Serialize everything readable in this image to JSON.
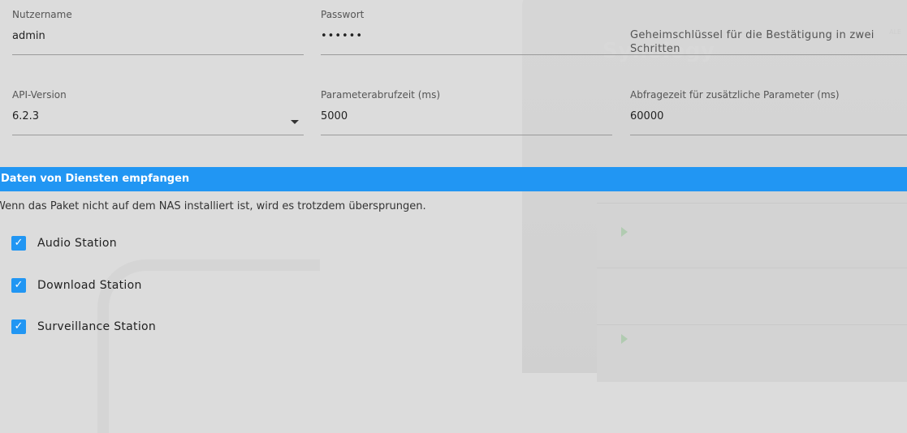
{
  "credentials": {
    "username_label": "Nutzername",
    "username_value": "admin",
    "password_label": "Passwort",
    "password_value": "••••••",
    "secret_label": "Geheimschlüssel für die Bestätigung in zwei Schritten"
  },
  "api": {
    "version_label": "API-Version",
    "version_value": "6.2.3",
    "poll_label": "Parameterabrufzeit (ms)",
    "poll_value": "5000",
    "extra_poll_label": "Abfragezeit für zusätzliche Parameter (ms)",
    "extra_poll_value": "60000"
  },
  "services": {
    "section_title": "Daten von Diensten empfangen",
    "hint": "Wenn das Paket nicht auf dem NAS installiert ist, wird es trotzdem übersprungen.",
    "items": [
      {
        "label": "Audio Station",
        "checked": true
      },
      {
        "label": "Download Station",
        "checked": true
      },
      {
        "label": "Surveillance Station",
        "checked": true
      }
    ]
  },
  "background": {
    "brand": "Synology",
    "brand_small": "ALE"
  },
  "colors": {
    "accent": "#2196f3",
    "background": "#dcdcdc"
  }
}
